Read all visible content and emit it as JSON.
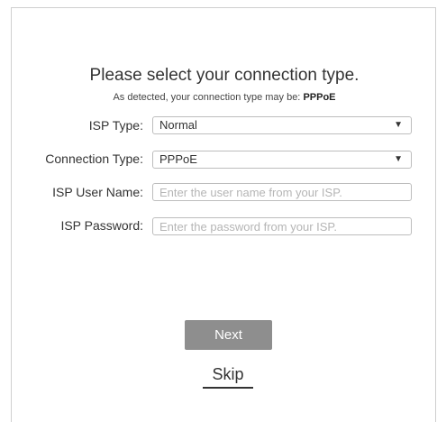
{
  "header": {
    "title": "Please select your connection type.",
    "detected_prefix": "As detected, your connection type may be: ",
    "detected_type": "PPPoE"
  },
  "form": {
    "isp_type": {
      "label": "ISP Type:",
      "value": "Normal"
    },
    "connection_type": {
      "label": "Connection Type:",
      "value": "PPPoE"
    },
    "isp_user_name": {
      "label": "ISP User Name:",
      "value": "",
      "placeholder": "Enter the user name from your ISP."
    },
    "isp_password": {
      "label": "ISP Password:",
      "value": "",
      "placeholder": "Enter the password from your ISP."
    }
  },
  "actions": {
    "next_label": "Next",
    "skip_label": "Skip"
  },
  "icons": {
    "dropdown_caret": "caret-down-icon"
  },
  "colors": {
    "next_button_bg": "#8e8e8e",
    "border": "#bdbdbd",
    "placeholder": "#b5b5b5"
  }
}
